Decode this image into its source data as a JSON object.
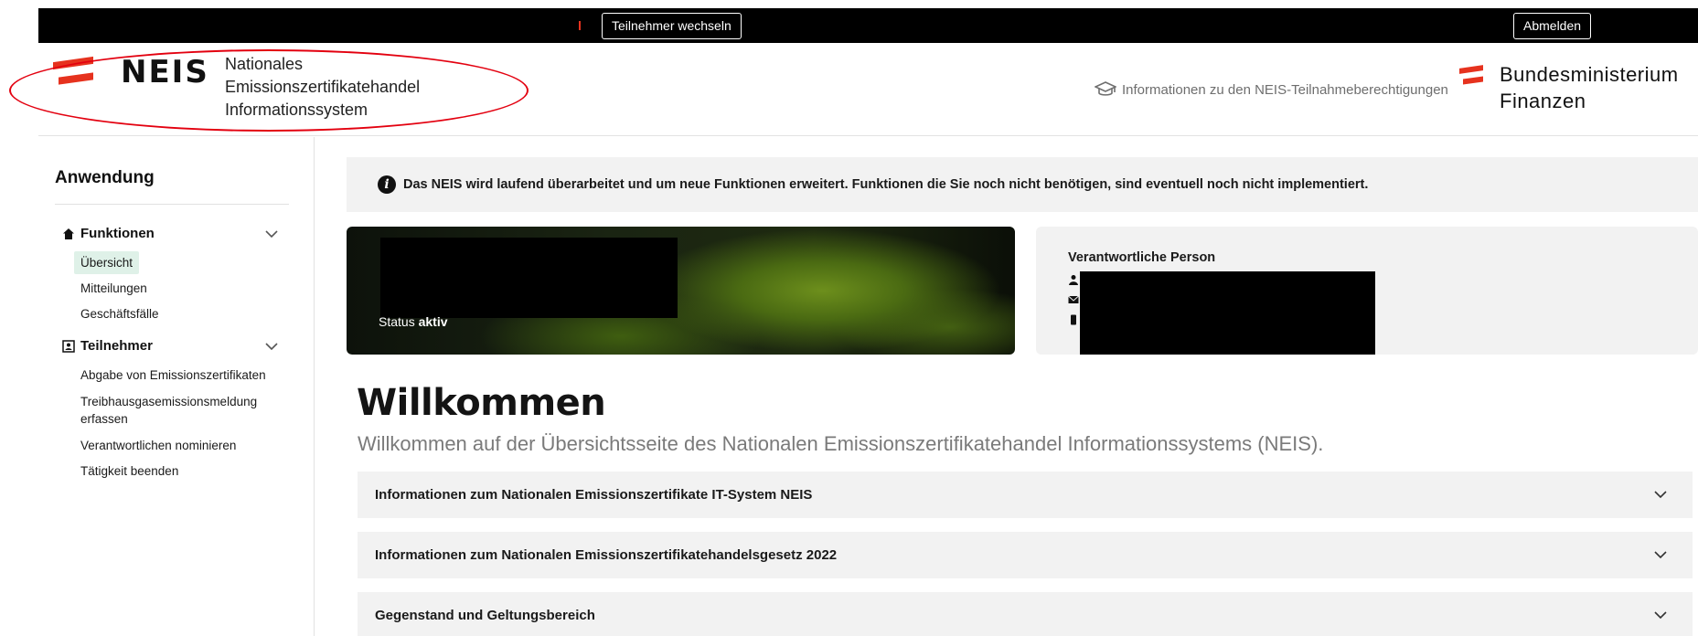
{
  "topbar": {
    "switch_label": "Teilnehmer wechseln",
    "logout_label": "Abmelden"
  },
  "header": {
    "logo_word": "NEIS",
    "logo_sub": [
      "Nationales",
      "Emissionszertifikatehandel",
      "Informationssystem"
    ],
    "info_link": "Informationen zu den NEIS-Teilnahmeberechtigungen",
    "ministry": [
      "Bundesministerium",
      "Finanzen"
    ]
  },
  "sidebar": {
    "title": "Anwendung",
    "groups": [
      {
        "label": "Funktionen",
        "items": [
          "Übersicht",
          "Mitteilungen",
          "Geschäftsfälle"
        ]
      },
      {
        "label": "Teilnehmer",
        "items": [
          "Abgabe von Emissionszertifikaten",
          "Treibhausgasemissionsmeldung",
          "erfassen",
          "Verantwortlichen nominieren",
          "Tätigkeit beenden"
        ]
      }
    ]
  },
  "notice": {
    "text": "Das NEIS wird laufend überarbeitet und um neue Funktionen erweitert. Funktionen die Sie noch nicht benötigen, sind eventuell noch nicht implementiert."
  },
  "hero": {
    "status_label": "Status",
    "status_value": "aktiv"
  },
  "contact": {
    "title": "Verantwortliche Person"
  },
  "main": {
    "welcome_title": "Willkommen",
    "welcome_sub": "Willkommen auf der Übersichtsseite des Nationalen Emissionszertifikatehandel Informationssystems (NEIS).",
    "accordions": [
      "Informationen zum Nationalen Emissionszertifikate IT-System NEIS",
      "Informationen zum Nationalen Emissionszertifikatehandelsgesetz 2022",
      "Gegenstand und Geltungsbereich"
    ]
  },
  "colors": {
    "accent_red": "#e6321e",
    "active_item_bg": "#dff1e8",
    "panel_bg": "#f2f2f2"
  }
}
